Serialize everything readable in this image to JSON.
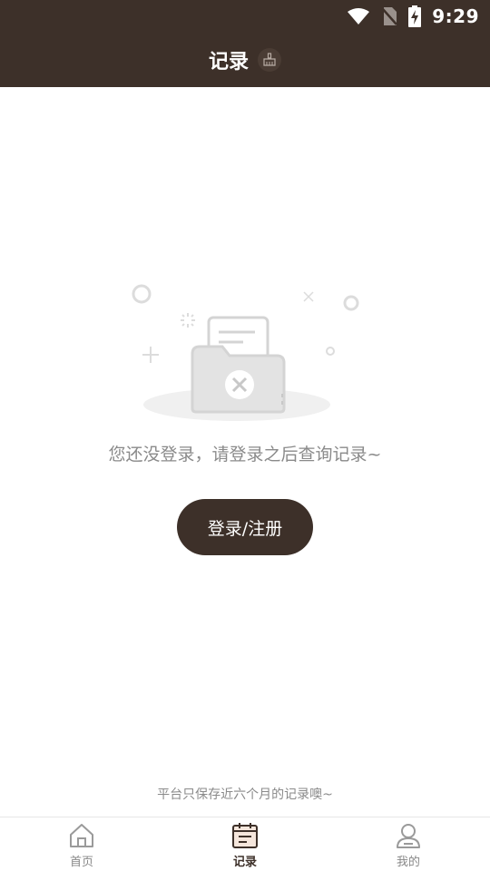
{
  "status_bar": {
    "time": "9:29",
    "icons": [
      "wifi-icon",
      "no-sim-icon",
      "battery-charging-icon"
    ]
  },
  "header": {
    "title": "记录",
    "clear_icon": "broom-icon"
  },
  "empty_state": {
    "illustration": "empty-folder-icon",
    "message": "您还没登录，请登录之后查询记录~",
    "button_label": "登录/注册"
  },
  "footer_note": "平台只保存近六个月的记录噢~",
  "tab_bar": {
    "items": [
      {
        "label": "首页",
        "icon": "home-icon",
        "active": false
      },
      {
        "label": "记录",
        "icon": "calendar-note-icon",
        "active": true
      },
      {
        "label": "我的",
        "icon": "user-icon",
        "active": false
      }
    ]
  },
  "colors": {
    "primary": "#3d3029",
    "muted_text": "#8a8a8a",
    "background": "#ffffff"
  }
}
